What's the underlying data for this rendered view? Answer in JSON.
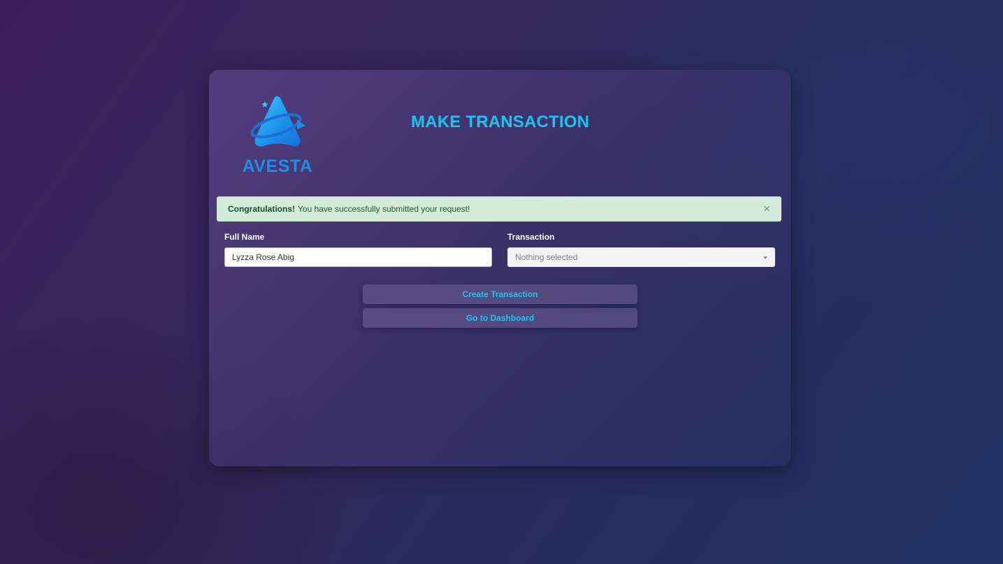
{
  "brand": {
    "name": "AVESTA",
    "logo_icon": "avesta-triangle-logo-icon",
    "color": "#1a8fe8"
  },
  "page": {
    "title": "MAKE TRANSACTION",
    "accent_color": "#12c7f0"
  },
  "alert": {
    "strong": "Congratulations!",
    "message": "You have successfully submitted your request!",
    "close_symbol": "×",
    "close_icon": "close-icon"
  },
  "form": {
    "full_name": {
      "label": "Full Name",
      "value": "Lyzza Rose Abig"
    },
    "transaction": {
      "label": "Transaction",
      "selected": "Nothing selected",
      "icon": "caret-down-icon"
    }
  },
  "actions": {
    "create_label": "Create Transaction",
    "dashboard_label": "Go to Dashboard"
  }
}
